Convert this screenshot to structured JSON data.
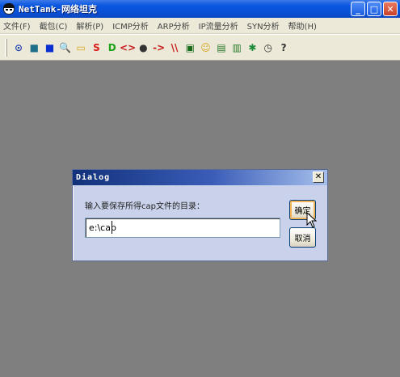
{
  "window": {
    "title": "NetTank-网络坦克",
    "controls": {
      "minimize": "_",
      "maximize": "□",
      "close": "✕"
    }
  },
  "menu": [
    "文件(F)",
    "截包(C)",
    "解析(P)",
    "ICMP分析",
    "ARP分析",
    "IP流量分析",
    "SYN分析",
    "帮助(H)"
  ],
  "toolbar": {
    "icons": [
      {
        "name": "start-capture-icon",
        "glyph": "⊙",
        "color": "#1a3fb0"
      },
      {
        "name": "stop-icon",
        "glyph": "■",
        "color": "#1f6f8a"
      },
      {
        "name": "pause-icon",
        "glyph": "■",
        "color": "#0a2fd0"
      },
      {
        "name": "search-icon",
        "glyph": "🔍",
        "color": "#1a3fb0"
      },
      {
        "name": "open-folder-icon",
        "glyph": "▭",
        "color": "#d9a520"
      },
      {
        "name": "s-letter-icon",
        "glyph": "S",
        "color": "#d81a1a"
      },
      {
        "name": "d-letter-icon",
        "glyph": "D",
        "color": "#1aa31a"
      },
      {
        "name": "code-brackets-icon",
        "glyph": "<>",
        "color": "#c81a1a"
      },
      {
        "name": "bomb-icon",
        "glyph": "●",
        "color": "#333333"
      },
      {
        "name": "arrow-right-icon",
        "glyph": "->",
        "color": "#c81a1a"
      },
      {
        "name": "double-slash-icon",
        "glyph": "\\\\",
        "color": "#c81a1a"
      },
      {
        "name": "book-icon",
        "glyph": "▣",
        "color": "#1a6a1a"
      },
      {
        "name": "smiley-icon",
        "glyph": "☺",
        "color": "#d9a520"
      },
      {
        "name": "notepad-icon",
        "glyph": "▤",
        "color": "#2a7a2a"
      },
      {
        "name": "edit-icon",
        "glyph": "▥",
        "color": "#2a7a2a"
      },
      {
        "name": "network-icon",
        "glyph": "✱",
        "color": "#1a8a3a"
      },
      {
        "name": "clock-icon",
        "glyph": "◷",
        "color": "#333333"
      },
      {
        "name": "help-icon",
        "glyph": "?",
        "color": "#333333"
      }
    ]
  },
  "dialog": {
    "title": "Dialog",
    "close": "✕",
    "prompt": "输入要保存所得cap文件的目录：",
    "input_value": "e:\\cap",
    "ok_label": "确定",
    "cancel_label": "取消"
  },
  "colors": {
    "workspace": "#7f7f7f",
    "dialog_bg": "#c9d2ea",
    "titlebar": "#0b58e0"
  }
}
